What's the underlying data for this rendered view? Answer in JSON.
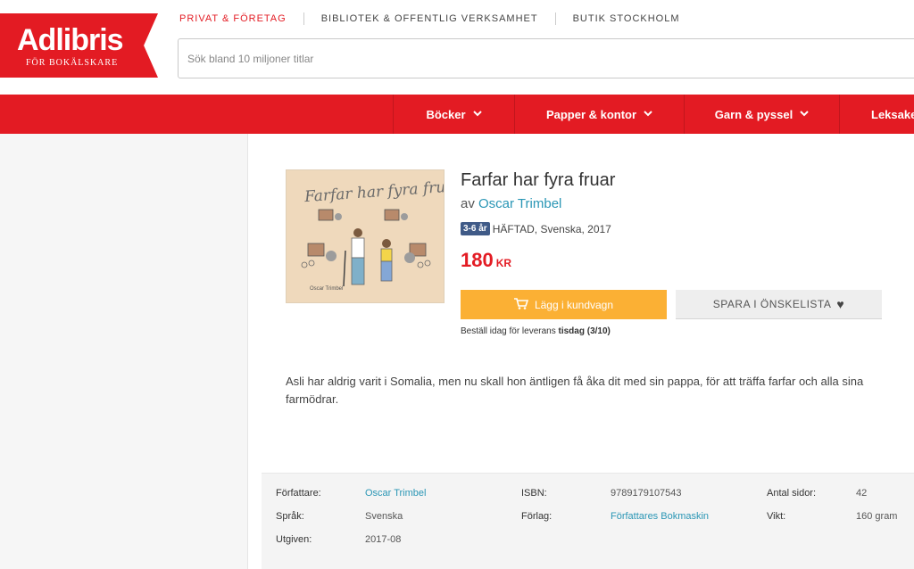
{
  "brand": {
    "name": "Adlibris",
    "tagline": "FÖR BOKÄLSKARE",
    "color": "#e31b23"
  },
  "topnav": [
    {
      "label": "PRIVAT & FÖRETAG",
      "active": true
    },
    {
      "label": "BIBLIOTEK & OFFENTLIG VERKSAMHET",
      "active": false
    },
    {
      "label": "BUTIK STOCKHOLM",
      "active": false
    }
  ],
  "search": {
    "placeholder": "Sök bland 10 miljoner titlar",
    "value": ""
  },
  "categories": [
    {
      "label": "Böcker",
      "icon": "chevron-down-icon"
    },
    {
      "label": "Papper & kontor",
      "icon": "chevron-down-icon"
    },
    {
      "label": "Garn & pyssel",
      "icon": "chevron-down-icon"
    },
    {
      "label": "Leksaker"
    }
  ],
  "product": {
    "cover": {
      "title": "Farfar har fyra fruar",
      "author": "Oscar Trimbel"
    },
    "title": "Farfar har fyra fruar",
    "by_prefix": "av",
    "author": "Oscar Trimbel",
    "age_badge": "3-6 år",
    "format": "HÄFTAD, Svenska, 2017",
    "price": "180",
    "currency": "KR",
    "buy_label": "Lägg i kundvagn",
    "wishlist_label": "SPARA I ÖNSKELISTA",
    "delivery_prefix": "Beställ idag för leverans",
    "delivery_date": "tisdag (3/10)",
    "description": "Asli har aldrig varit i Somalia, men nu skall hon äntligen få åka dit med sin pappa, för att träffa farfar och alla sina farmödrar."
  },
  "details": {
    "author_label": "Författare:",
    "author_value": "Oscar Trimbel",
    "language_label": "Språk:",
    "language_value": "Svenska",
    "published_label": "Utgiven:",
    "published_value": "2017-08",
    "isbn_label": "ISBN:",
    "isbn_value": "9789179107543",
    "publisher_label": "Förlag:",
    "publisher_value": "Författares Bokmaskin",
    "pages_label": "Antal sidor:",
    "pages_value": "42",
    "weight_label": "Vikt:",
    "weight_value": "160 gram"
  }
}
